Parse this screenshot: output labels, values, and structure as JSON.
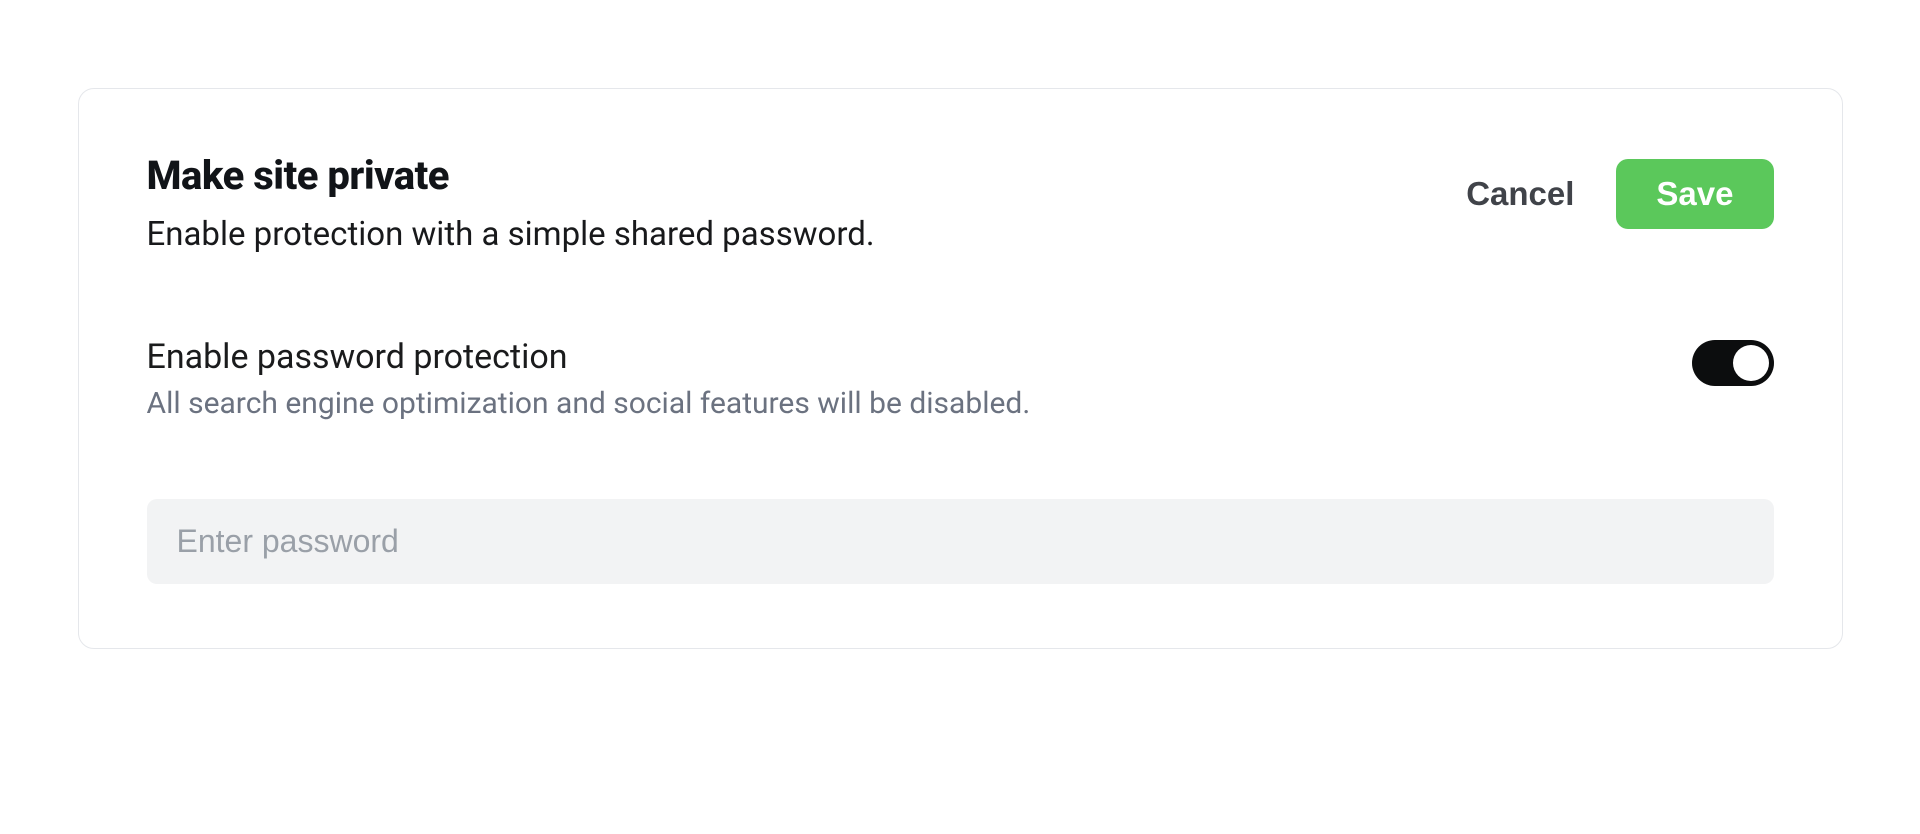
{
  "header": {
    "title": "Make site private",
    "subtitle": "Enable protection with a simple shared password.",
    "cancel_label": "Cancel",
    "save_label": "Save"
  },
  "option": {
    "title": "Enable password protection",
    "description": "All search engine optimization and social features will be disabled.",
    "enabled": true
  },
  "password_input": {
    "placeholder": "Enter password",
    "value": ""
  },
  "colors": {
    "primary_button": "#5bc85b",
    "toggle_on": "#0c0d0e",
    "card_border": "#e5e7eb",
    "input_bg": "#f2f3f4",
    "muted_text": "#6b7280"
  }
}
